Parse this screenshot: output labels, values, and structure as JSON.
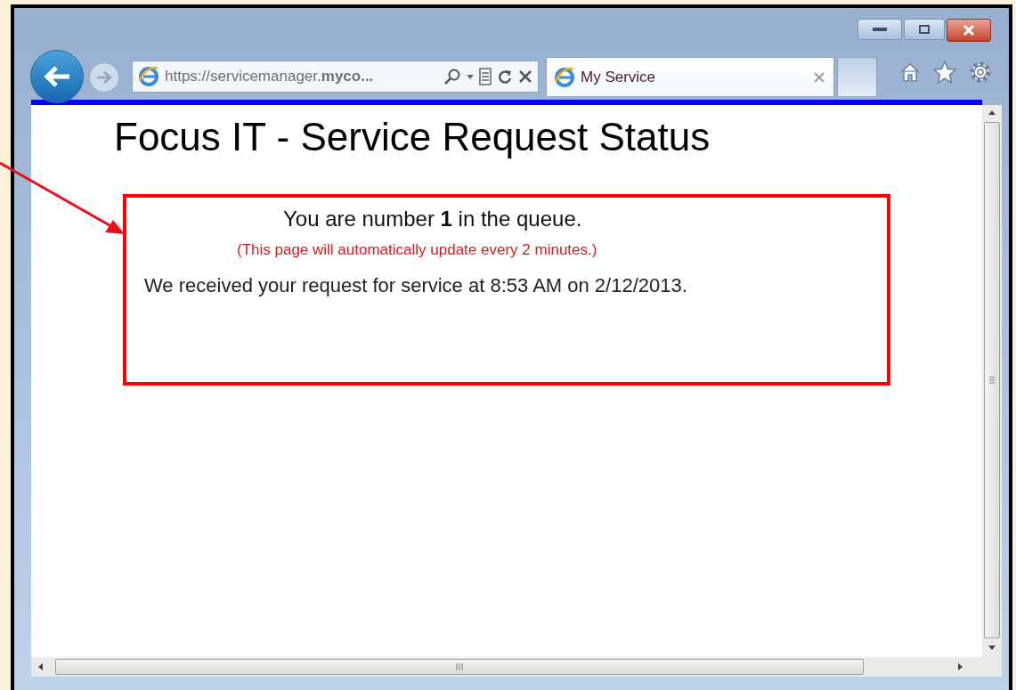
{
  "browser": {
    "address": "https://servicemanager.**myco...**",
    "tab": {
      "title": "My Service",
      "selected": true
    }
  },
  "page": {
    "title": "Focus IT - Service Request Status",
    "queue_message": "You are number **1** in the queue.",
    "refresh_note": "(This page will automatically update every 2 minutes.)",
    "received_message": "We received your request for service at 8:53 AM on 2/12/2013."
  }
}
